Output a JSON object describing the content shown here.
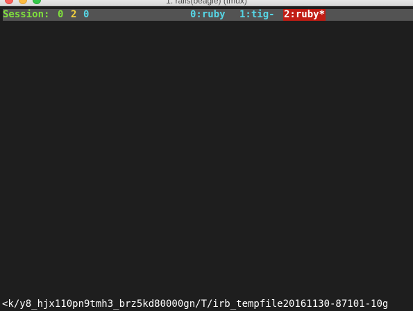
{
  "window": {
    "title": "1. rails(beagle) (tmux)"
  },
  "status_bar": {
    "session_label": "Session:",
    "session_numbers": [
      "0",
      "2",
      "0"
    ],
    "windows": [
      {
        "label": "0:ruby",
        "active": false
      },
      {
        "label": "1:tig-",
        "active": false
      },
      {
        "label": "2:ruby*",
        "active": true
      }
    ],
    "colors": {
      "background": "#535353",
      "green": "#7fe03c",
      "yellow": "#f5d33d",
      "cyan": "#56d6e6",
      "active_window_bg": "#c11d14"
    }
  },
  "terminal": {
    "background": "#1e1e1e",
    "bottom_line": "<k/y8_hjx110pn9tmh3_brz5kd80000gn/T/irb_tempfile20161130-87101-10g"
  }
}
